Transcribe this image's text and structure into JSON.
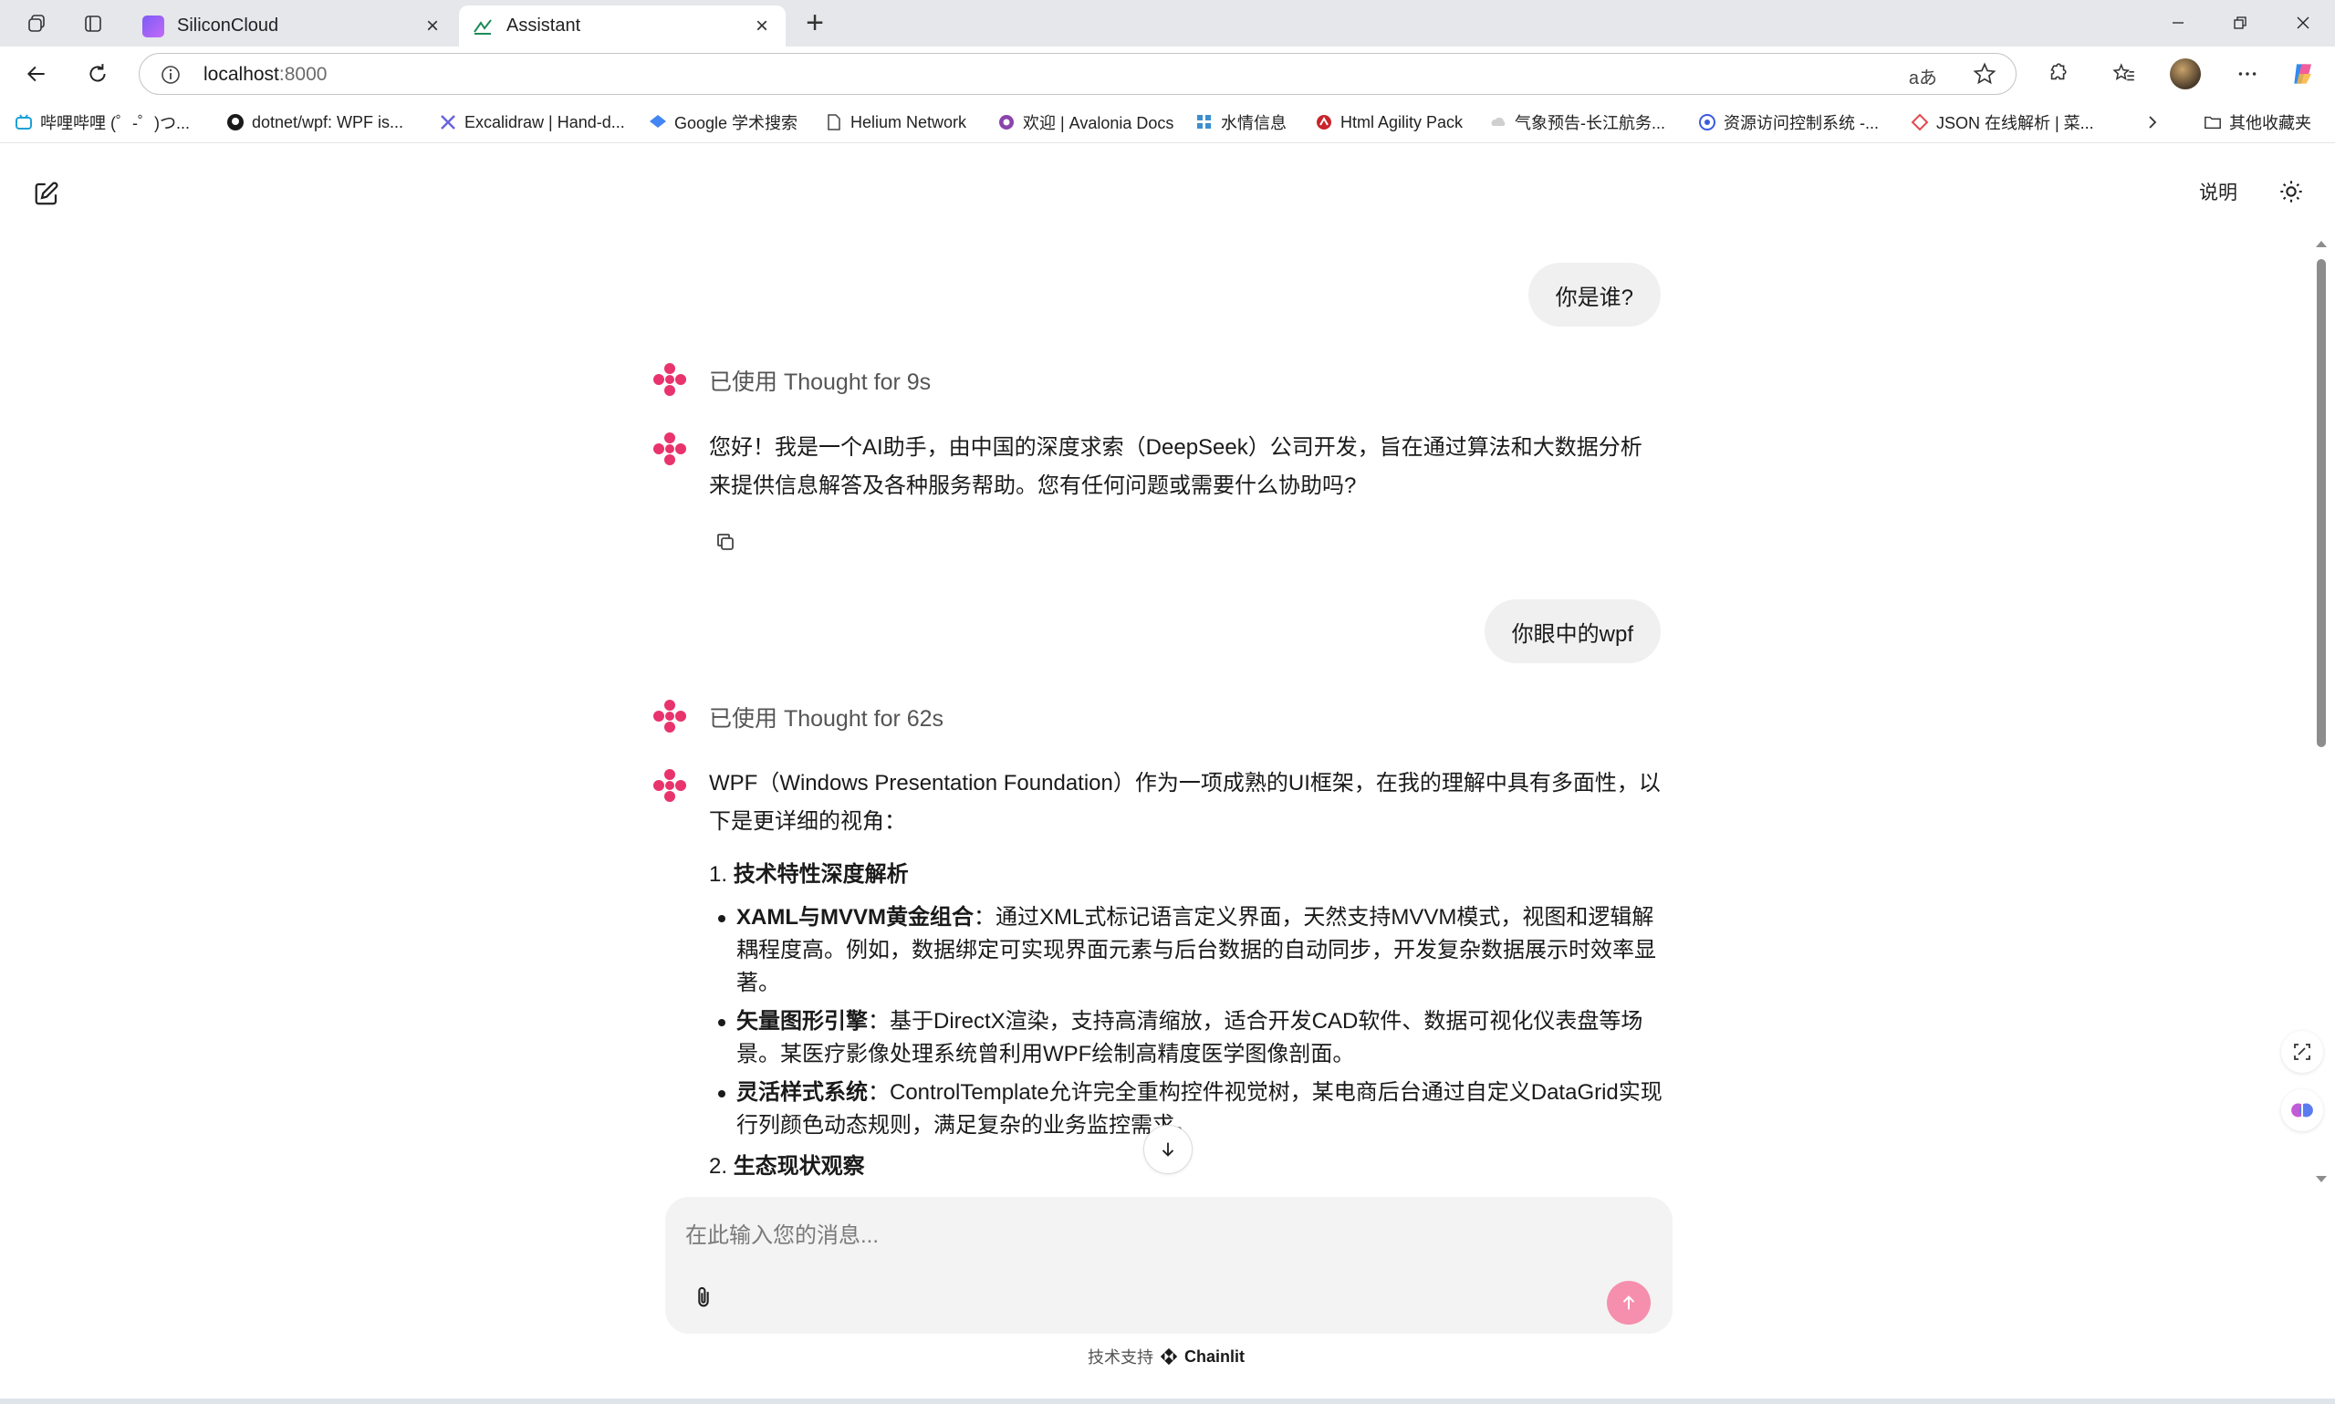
{
  "browser": {
    "tabs": [
      {
        "title": "SiliconCloud",
        "active": false
      },
      {
        "title": "Assistant",
        "active": true
      }
    ],
    "address": {
      "host": "localhost",
      "port": ":8000"
    },
    "read_aloud_label": "aあ",
    "bookmarks": [
      {
        "label": "哔哩哔哩 (゜-゜)つ...",
        "icon": "bilibili-icon"
      },
      {
        "label": "dotnet/wpf: WPF is...",
        "icon": "github-icon"
      },
      {
        "label": "Excalidraw | Hand-d...",
        "icon": "excalidraw-icon"
      },
      {
        "label": "Google 学术搜索",
        "icon": "scholar-icon"
      },
      {
        "label": "Helium Network",
        "icon": "document-icon"
      },
      {
        "label": "欢迎 | Avalonia Docs",
        "icon": "avalonia-icon"
      },
      {
        "label": "水情信息",
        "icon": "grid-icon"
      },
      {
        "label": "Html Agility Pack",
        "icon": "htmlagility-icon"
      },
      {
        "label": "气象预告-长江航务...",
        "icon": "weather-icon"
      },
      {
        "label": "资源访问控制系统 -...",
        "icon": "access-icon"
      },
      {
        "label": "JSON 在线解析 | 菜...",
        "icon": "json-icon"
      }
    ],
    "other_bookmarks": "其他收藏夹"
  },
  "app": {
    "readme_label": "说明",
    "messages": {
      "user1": "你是谁?",
      "thought1": "已使用 Thought for 9s",
      "answer1": "您好！我是一个AI助手，由中国的深度求索（DeepSeek）公司开发，旨在通过算法和大数据分析来提供信息解答及各种服务帮助。您有任何问题或需要什么协助吗?",
      "user2": "你眼中的wpf",
      "thought2": "已使用 Thought for 62s",
      "answer2": {
        "intro": "WPF（Windows Presentation Foundation）作为一项成熟的UI框架，在我的理解中具有多面性，以下是更详细的视角：",
        "section1_num": "1.",
        "section1_title": "技术特性深度解析",
        "bullets": [
          {
            "bold": "XAML与MVVM黄金组合",
            "text": "：通过XML式标记语言定义界面，天然支持MVVM模式，视图和逻辑解耦程度高。例如，数据绑定可实现界面元素与后台数据的自动同步，开发复杂数据展示时效率显著。"
          },
          {
            "bold": "矢量图形引擎",
            "text": "：基于DirectX渲染，支持高清缩放，适合开发CAD软件、数据可视化仪表盘等场景。某医疗影像处理系统曾利用WPF绘制高精度医学图像剖面。"
          },
          {
            "bold": "灵活样式系统",
            "text": "：ControlTemplate允许完全重构控件视觉树，某电商后台通过自定义DataGrid实现行列颜色动态规则，满足复杂的业务监控需求。"
          }
        ],
        "section2_num": "2.",
        "section2_title": "生态现状观察"
      }
    },
    "composer": {
      "placeholder": "在此输入您的消息..."
    },
    "footer": {
      "prefix": "技术支持",
      "brand": "Chainlit"
    }
  },
  "colors": {
    "accent": "#e8336d",
    "send_button": "#f58fad",
    "user_bubble": "#f0f0f0"
  }
}
